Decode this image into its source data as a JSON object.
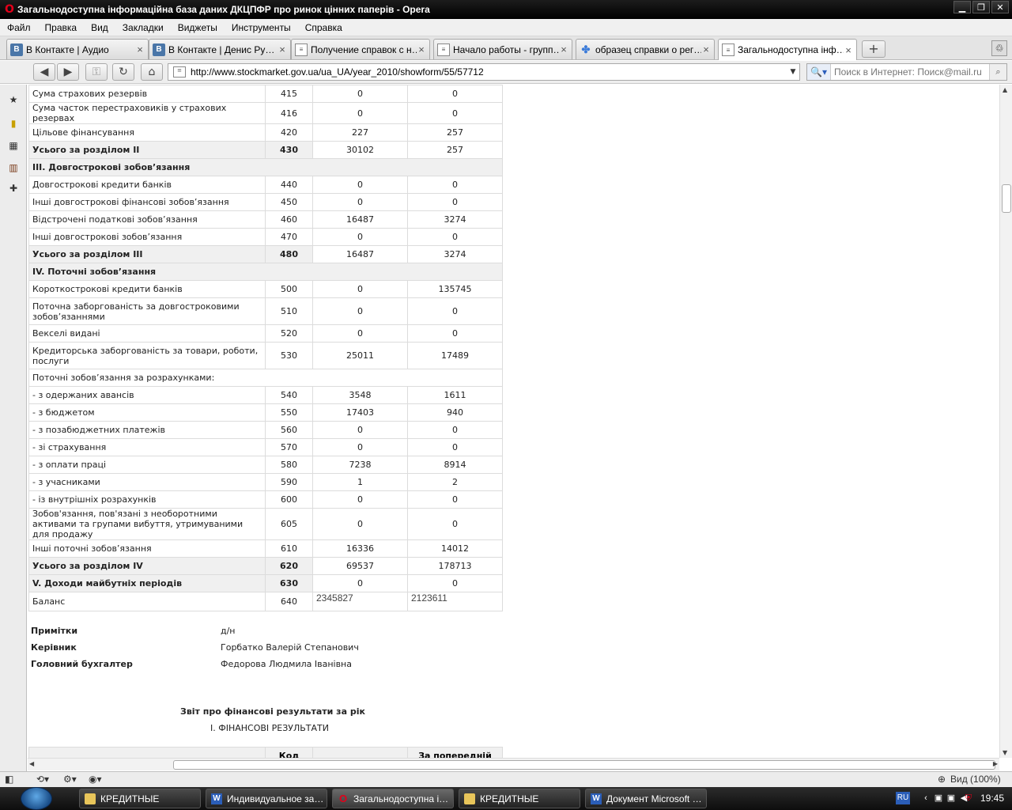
{
  "window": {
    "title": "Загальнодоступна інформаційна база даних ДКЦПФР про ринок цінних паперів - Opera",
    "buttons": [
      "▁",
      "❐",
      "✕"
    ]
  },
  "menu": [
    "Файл",
    "Правка",
    "Вид",
    "Закладки",
    "Виджеты",
    "Инструменты",
    "Справка"
  ],
  "tabs": [
    {
      "label": "В Контакте | Аудио",
      "icon": "vk"
    },
    {
      "label": "В Контакте | Денис Ру…",
      "icon": "vk"
    },
    {
      "label": "Получение справок с н…",
      "icon": "doc"
    },
    {
      "label": "Начало работы - групп…",
      "icon": "doc"
    },
    {
      "label": "образец справки о рег…",
      "icon": "google"
    },
    {
      "label": "Загальнодоступна інф…",
      "icon": "doc",
      "active": true
    }
  ],
  "address": {
    "url": "http://www.stockmarket.gov.ua/ua_UA/year_2010/showform/55/57712",
    "search_placeholder": "Поиск в Интернет: Поиск@mail.ru"
  },
  "balance_rows": [
    {
      "name": "Сума страхових резервів",
      "code": "415",
      "v1": "0",
      "v2": "0"
    },
    {
      "name": "Сума часток перестраховиків у страхових резервах",
      "code": "416",
      "v1": "0",
      "v2": "0"
    },
    {
      "name": "Цільове фінансування",
      "code": "420",
      "v1": "227",
      "v2": "257"
    },
    {
      "name": "Усього за розділом II",
      "code": "430",
      "v1": "30102",
      "v2": "257",
      "type": "total"
    },
    {
      "name": "III. Довгострокові зобов’язання",
      "type": "section"
    },
    {
      "name": "Довгострокові кредити банків",
      "code": "440",
      "v1": "0",
      "v2": "0"
    },
    {
      "name": "Інші довгострокові фінансові зобов’язання",
      "code": "450",
      "v1": "0",
      "v2": "0"
    },
    {
      "name": "Відстрочені податкові зобов’язання",
      "code": "460",
      "v1": "16487",
      "v2": "3274"
    },
    {
      "name": "Інші довгострокові зобов’язання",
      "code": "470",
      "v1": "0",
      "v2": "0"
    },
    {
      "name": "Усього за розділом III",
      "code": "480",
      "v1": "16487",
      "v2": "3274",
      "type": "total"
    },
    {
      "name": "IV. Поточні зобов’язання",
      "type": "section"
    },
    {
      "name": "Короткострокові кредити банків",
      "code": "500",
      "v1": "0",
      "v2": "135745"
    },
    {
      "name": "Поточна заборгованість за довгостроковими зобов’язаннями",
      "code": "510",
      "v1": "0",
      "v2": "0",
      "tall": true
    },
    {
      "name": "Векселі видані",
      "code": "520",
      "v1": "0",
      "v2": "0"
    },
    {
      "name": "Кредиторська заборгованість за товари, роботи, послуги",
      "code": "530",
      "v1": "25011",
      "v2": "17489",
      "tall": true
    },
    {
      "name": "Поточні зобов’язання за розрахунками:",
      "type": "sub"
    },
    {
      "name": "- з одержаних авансів",
      "code": "540",
      "v1": "3548",
      "v2": "1611"
    },
    {
      "name": "- з бюджетом",
      "code": "550",
      "v1": "17403",
      "v2": "940"
    },
    {
      "name": "- з позабюджетних платежів",
      "code": "560",
      "v1": "0",
      "v2": "0"
    },
    {
      "name": "- зі страхування",
      "code": "570",
      "v1": "0",
      "v2": "0"
    },
    {
      "name": "- з оплати праці",
      "code": "580",
      "v1": "7238",
      "v2": "8914"
    },
    {
      "name": "- з учасниками",
      "code": "590",
      "v1": "1",
      "v2": "2"
    },
    {
      "name": "- із внутрішніх розрахунків",
      "code": "600",
      "v1": "0",
      "v2": "0"
    },
    {
      "name": "Зобов'язання, пов'язані з необоротними активами та групами вибуття, утримуваними для продажу",
      "code": "605",
      "v1": "0",
      "v2": "0",
      "tall": true
    },
    {
      "name": "Інші поточні зобов’язання",
      "code": "610",
      "v1": "16336",
      "v2": "14012"
    },
    {
      "name": "Усього за розділом IV",
      "code": "620",
      "v1": "69537",
      "v2": "178713",
      "type": "total"
    },
    {
      "name": "V. Доходи майбутніх періодів",
      "code": "630",
      "v1": "0",
      "v2": "0",
      "type": "total"
    },
    {
      "name": "Баланс",
      "code": "640",
      "v1": "2345827",
      "v2": "2123611",
      "type": "balance"
    }
  ],
  "signatures": [
    {
      "label": "Примітки",
      "value": "д/н"
    },
    {
      "label": "Керівник",
      "value": "Горбатко Валерій Степанович"
    },
    {
      "label": "Головний бухгалтер",
      "value": "Федорова Людмила Іванівна"
    }
  ],
  "report": {
    "title": "Звіт про фінансові результати за рік",
    "subtitle": "I. ФІНАНСОВІ РЕЗУЛЬТАТИ",
    "header_code": "Код",
    "header_prev": "За попередній"
  },
  "status": {
    "zoom": "Вид (100%)"
  },
  "taskbar": [
    {
      "label": "КРЕДИТНЫЕ",
      "icon": "folder"
    },
    {
      "label": "Индивидуальное за…",
      "icon": "word"
    },
    {
      "label": "Загальнодоступна і…",
      "icon": "opera",
      "active": true
    },
    {
      "label": "КРЕДИТНЫЕ",
      "icon": "folder"
    },
    {
      "label": "Документ Microsoft …",
      "icon": "word"
    }
  ],
  "tray": {
    "lang": "RU",
    "clock": "19:45"
  }
}
